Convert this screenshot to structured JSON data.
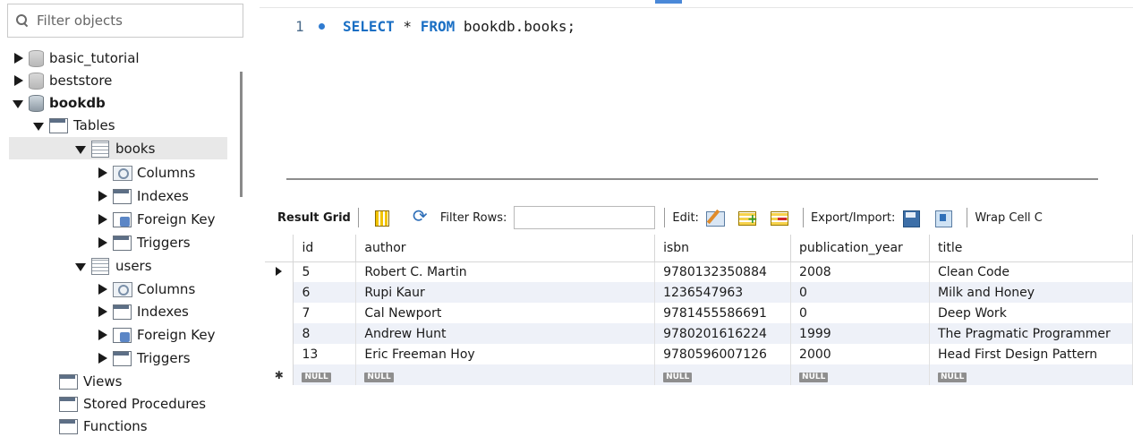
{
  "navigator": {
    "filter_placeholder": "Filter objects",
    "schemas": [
      {
        "name": "basic_tutorial"
      },
      {
        "name": "beststore"
      },
      {
        "name": "bookdb"
      }
    ],
    "tables_label": "Tables",
    "tables": [
      {
        "name": "books",
        "children": [
          "Columns",
          "Indexes",
          "Foreign Key",
          "Triggers"
        ]
      },
      {
        "name": "users",
        "children": [
          "Columns",
          "Indexes",
          "Foreign Key",
          "Triggers"
        ]
      }
    ],
    "views_label": "Views",
    "stored_procedures_label": "Stored Procedures",
    "functions_label": "Functions"
  },
  "editor": {
    "line_number": "1",
    "keyword_select": "SELECT",
    "star": " * ",
    "keyword_from": "FROM",
    "target": " bookdb.books;"
  },
  "result_toolbar": {
    "result_grid_label": "Result Grid",
    "filter_rows_label": "Filter Rows:",
    "edit_label": "Edit:",
    "export_import_label": "Export/Import:",
    "wrap_cell_label": "Wrap Cell C"
  },
  "grid": {
    "columns": [
      "id",
      "author",
      "isbn",
      "publication_year",
      "title"
    ],
    "rows": [
      [
        "5",
        "Robert C. Martin",
        "9780132350884",
        "2008",
        "Clean Code"
      ],
      [
        "6",
        "Rupi Kaur",
        "1236547963",
        "0",
        "Milk and Honey"
      ],
      [
        "7",
        "Cal Newport",
        "9781455586691",
        "0",
        "Deep Work"
      ],
      [
        "8",
        "Andrew Hunt",
        "9780201616224",
        "1999",
        "The Pragmatic Programmer"
      ],
      [
        "13",
        "Eric Freeman Hoy",
        "9780596007126",
        "2000",
        "Head First Design Pattern"
      ]
    ],
    "null_label": "NULL",
    "new_row_marker": "✱"
  }
}
